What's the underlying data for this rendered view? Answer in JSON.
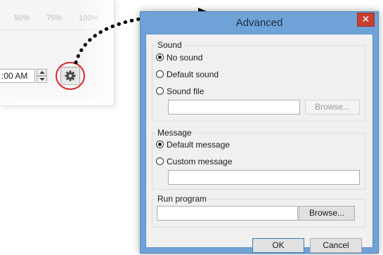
{
  "background_window": {
    "percent_labels": [
      "50%",
      "75%",
      "100%"
    ],
    "time_value": ":00 AM",
    "settings_button_icon": "gear-icon"
  },
  "dialog": {
    "title": "Advanced",
    "close_glyph": "✕",
    "sound": {
      "group_label": "Sound",
      "options": [
        "No sound",
        "Default sound",
        "Sound file"
      ],
      "selected": "No sound",
      "file_path": "",
      "browse_label": "Browse..."
    },
    "message": {
      "group_label": "Message",
      "options": [
        "Default message",
        "Custom message"
      ],
      "selected": "Default message",
      "custom_text": ""
    },
    "run_program": {
      "group_label": "Run program",
      "path": "",
      "browse_label": "Browse..."
    },
    "ok_label": "OK",
    "cancel_label": "Cancel"
  },
  "colors": {
    "titlebar_blue": "#6fa3d8",
    "close_red": "#c7402f",
    "highlight_red": "#d9252b",
    "arrow_black": "#000000"
  }
}
